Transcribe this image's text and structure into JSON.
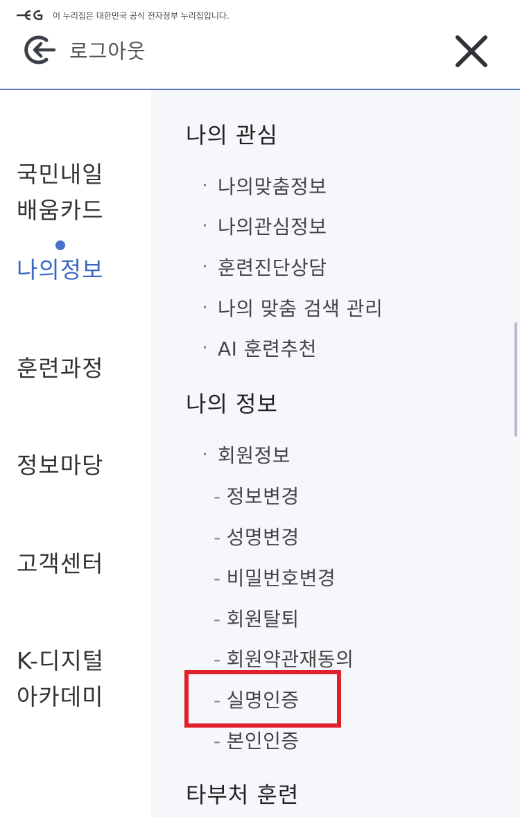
{
  "banner": {
    "text": "이 누리집은 대한민국 공식 전자정부 누리집입니다."
  },
  "header": {
    "logout_label": "로그아웃"
  },
  "left_nav": {
    "items": [
      {
        "label_lines": [
          "국민내일",
          "배움카드"
        ],
        "active": false
      },
      {
        "label_lines": [
          "나의정보"
        ],
        "active": true
      },
      {
        "label_lines": [
          "훈련과정"
        ],
        "active": false
      },
      {
        "label_lines": [
          "정보마당"
        ],
        "active": false
      },
      {
        "label_lines": [
          "고객센터"
        ],
        "active": false
      },
      {
        "label_lines": [
          "K-디지털",
          "아카데미"
        ],
        "active": false
      }
    ]
  },
  "panel": {
    "sections": [
      {
        "title": "나의 관심",
        "items": [
          "나의맞춤정보",
          "나의관심정보",
          "훈련진단상담",
          "나의 맞춤 검색 관리",
          "AI 훈련추천"
        ]
      },
      {
        "title": "나의 정보",
        "items": [
          "회원정보"
        ],
        "sub_items": [
          "정보변경",
          "성명변경",
          "비밀번호변경",
          "회원탈퇴",
          "회원약관재동의",
          "실명인증",
          "본인인증"
        ]
      },
      {
        "title": "타부처 훈련"
      }
    ],
    "bullet": "·",
    "dash": "-"
  },
  "colors": {
    "accent": "#3a66c8",
    "highlight": "#e0202a",
    "panel_bg": "#f6f7fb"
  },
  "icons": {
    "gov_logo": "egov-logo-icon",
    "logout": "logout-icon",
    "close": "close-icon"
  }
}
